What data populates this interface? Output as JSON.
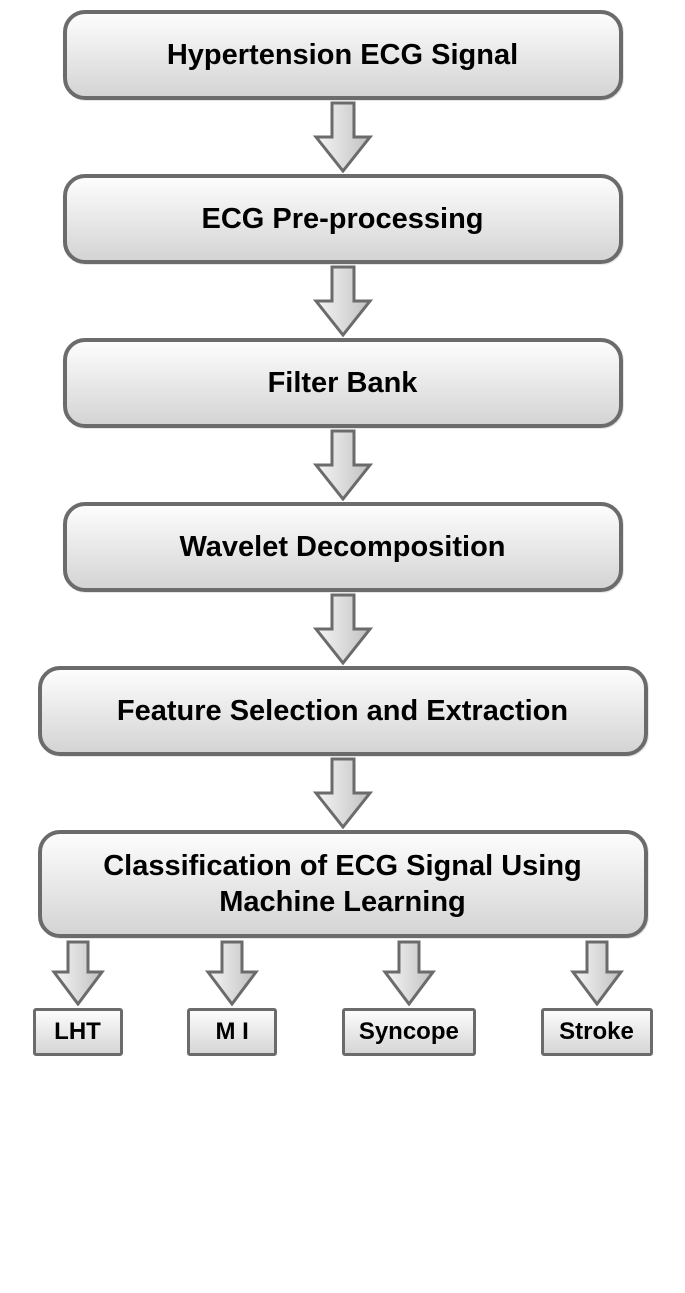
{
  "stages": [
    "Hypertension ECG Signal",
    "ECG  Pre-processing",
    "Filter Bank",
    "Wavelet Decomposition",
    "Feature Selection and  Extraction",
    "Classification of ECG Signal Using  Machine Learning"
  ],
  "outputs": [
    "LHT",
    "M I",
    "Syncope",
    "Stroke"
  ]
}
